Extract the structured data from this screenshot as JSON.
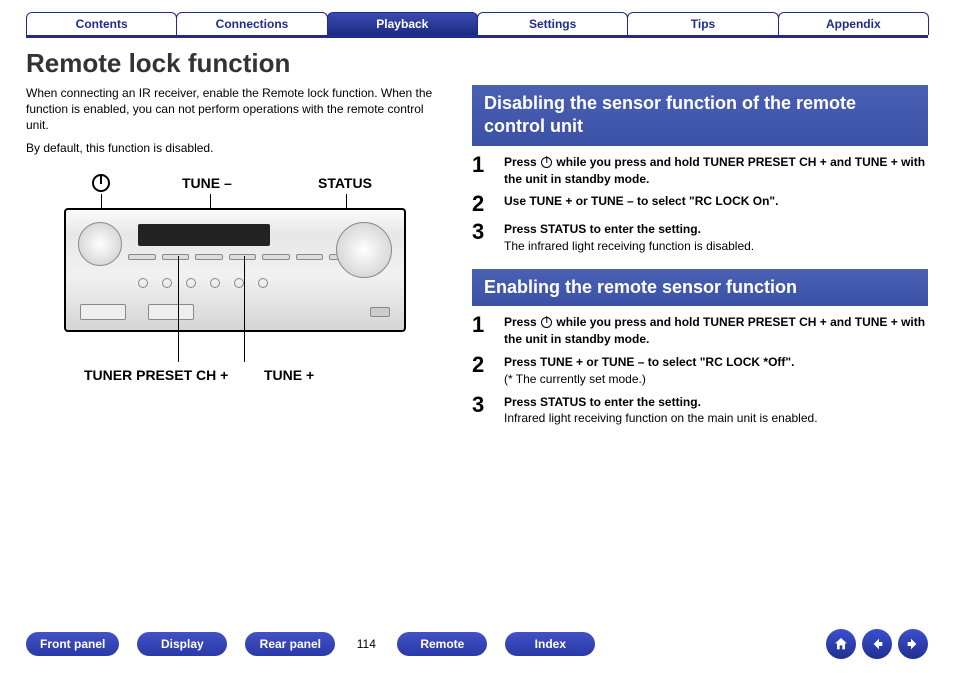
{
  "tabs": [
    {
      "label": "Contents",
      "active": false
    },
    {
      "label": "Connections",
      "active": false
    },
    {
      "label": "Playback",
      "active": true
    },
    {
      "label": "Settings",
      "active": false
    },
    {
      "label": "Tips",
      "active": false
    },
    {
      "label": "Appendix",
      "active": false
    }
  ],
  "title": "Remote lock function",
  "intro": {
    "p1": "When connecting an IR receiver, enable the Remote lock function. When the function is enabled, you can not perform operations with the remote control unit.",
    "p2": "By default, this function is disabled."
  },
  "figure_labels": {
    "power_icon": "power-icon",
    "tune_minus": "TUNE –",
    "status": "STATUS",
    "tuner_preset_ch_plus": "TUNER PRESET CH +",
    "tune_plus": "TUNE +"
  },
  "sections": [
    {
      "heading": "Disabling the sensor function of the remote control unit",
      "steps": [
        {
          "num": "1",
          "bold_pre": "Press ",
          "bold_post": " while you press and hold TUNER PRESET CH + and TUNE + with the unit in standby mode.",
          "uses_power_icon": true
        },
        {
          "num": "2",
          "bold": "Use TUNE + or TUNE – to select \"RC LOCK On\"."
        },
        {
          "num": "3",
          "bold": "Press STATUS to enter the setting.",
          "note": "The infrared light receiving function is disabled."
        }
      ]
    },
    {
      "heading": "Enabling the remote sensor function",
      "steps": [
        {
          "num": "1",
          "bold_pre": "Press ",
          "bold_post": " while you press and hold TUNER PRESET CH + and TUNE + with the unit in standby mode.",
          "uses_power_icon": true
        },
        {
          "num": "2",
          "bold": "Press TUNE + or TUNE – to select \"RC LOCK *Off\".",
          "note": "(* The currently set mode.)"
        },
        {
          "num": "3",
          "bold": "Press STATUS to enter the setting.",
          "note": "Infrared light receiving function on the main unit is enabled."
        }
      ]
    }
  ],
  "footer": {
    "pills": [
      "Front panel",
      "Display",
      "Rear panel"
    ],
    "page": "114",
    "pills2": [
      "Remote",
      "Index"
    ],
    "nav": {
      "home": "home-icon",
      "prev": "arrow-left-icon",
      "next": "arrow-right-icon"
    }
  }
}
